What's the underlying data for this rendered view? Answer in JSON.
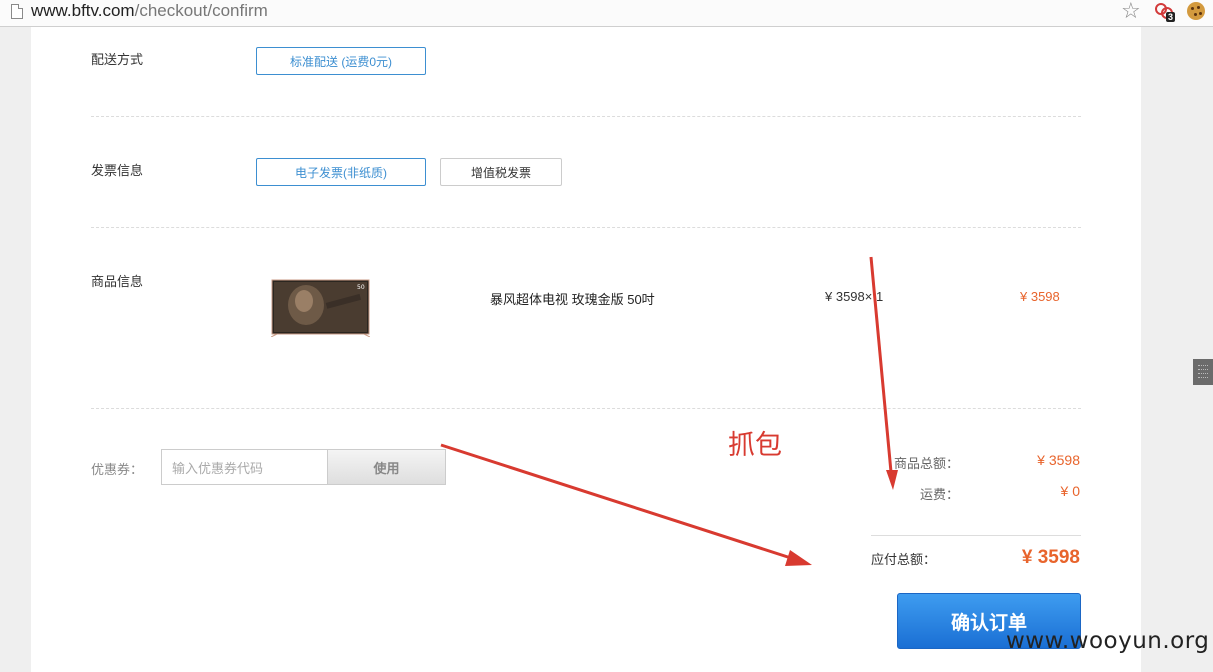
{
  "browser": {
    "url_host": "www.bftv.com",
    "url_path": "/checkout/confirm",
    "extension_badge": "3"
  },
  "delivery": {
    "label": "配送方式",
    "option": "标准配送 (运费0元)"
  },
  "invoice": {
    "label": "发票信息",
    "options": [
      "电子发票(非纸质)",
      "增值税发票"
    ]
  },
  "product": {
    "label": "商品信息",
    "name": "暴风超体电视 玫瑰金版 50吋",
    "unit_price": "¥ 3598",
    "quantity": "× 1",
    "subtotal": "¥ 3598"
  },
  "coupon": {
    "label": "优惠券：",
    "placeholder": "输入优惠券代码",
    "button": "使用"
  },
  "summary": {
    "goods_total_label": "商品总额：",
    "goods_total_value": "¥ 3598",
    "shipping_label": "运费：",
    "shipping_value": "¥ 0",
    "payable_label": "应付总额：",
    "payable_value": "¥ 3598"
  },
  "confirm_button": "确认订单",
  "annotation": "抓包",
  "watermark": "www.wooyun.org",
  "colors": {
    "accent_blue": "#3d8fd1",
    "price_orange": "#e8642c",
    "annotation_red": "#d83a30"
  }
}
